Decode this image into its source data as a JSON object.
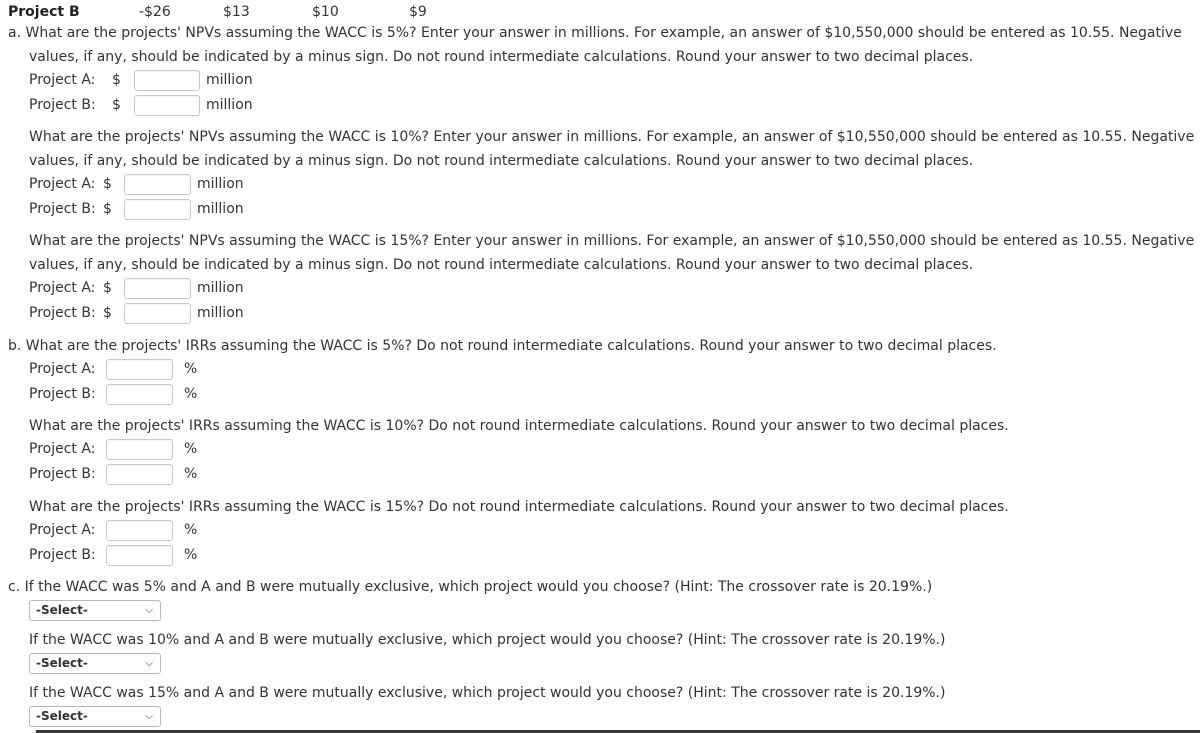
{
  "cash_flow_row": {
    "label": "Project B",
    "values": [
      "-$26",
      "$13",
      "$10",
      "$9"
    ]
  },
  "part_a": {
    "questions": [
      {
        "prefix": "a.",
        "line1": "What are the projects' NPVs assuming the WACC is 5%? Enter your answer in millions. For example, an answer of $10,550,000 should be entered as 10.55. Negative",
        "line2": "values, if any, should be indicated by a minus sign. Do not round intermediate calculations. Round your answer to two decimal places.",
        "rows": [
          {
            "label": "Project A:",
            "currency": "$",
            "value": "",
            "unit": "million"
          },
          {
            "label": "Project B:",
            "currency": "$",
            "value": "",
            "unit": "million"
          }
        ]
      },
      {
        "prefix": "",
        "line1": "What are the projects' NPVs assuming the WACC is 10%? Enter your answer in millions. For example, an answer of $10,550,000 should be entered as 10.55. Negative",
        "line2": "values, if any, should be indicated by a minus sign. Do not round intermediate calculations. Round your answer to two decimal places.",
        "rows": [
          {
            "label": "Project A:",
            "currency": "$",
            "value": "",
            "unit": "million"
          },
          {
            "label": "Project B:",
            "currency": "$",
            "value": "",
            "unit": "million"
          }
        ]
      },
      {
        "prefix": "",
        "line1": "What are the projects' NPVs assuming the WACC is 15%? Enter your answer in millions. For example, an answer of $10,550,000 should be entered as 10.55. Negative",
        "line2": "values, if any, should be indicated by a minus sign. Do not round intermediate calculations. Round your answer to two decimal places.",
        "rows": [
          {
            "label": "Project A:",
            "currency": "$",
            "value": "",
            "unit": "million"
          },
          {
            "label": "Project B:",
            "currency": "$",
            "value": "",
            "unit": "million"
          }
        ]
      }
    ]
  },
  "part_b": {
    "questions": [
      {
        "text": "b. What are the projects' IRRs assuming the WACC is 5%? Do not round intermediate calculations. Round your answer to two decimal places.",
        "rows": [
          {
            "label": "Project A:",
            "value": "",
            "unit": "%"
          },
          {
            "label": "Project B:",
            "value": "",
            "unit": "%"
          }
        ]
      },
      {
        "text": "What are the projects' IRRs assuming the WACC is 10%? Do not round intermediate calculations. Round your answer to two decimal places.",
        "rows": [
          {
            "label": "Project A:",
            "value": "",
            "unit": "%"
          },
          {
            "label": "Project B:",
            "value": "",
            "unit": "%"
          }
        ]
      },
      {
        "text": "What are the projects' IRRs assuming the WACC is 15%? Do not round intermediate calculations. Round your answer to two decimal places.",
        "rows": [
          {
            "label": "Project A:",
            "value": "",
            "unit": "%"
          },
          {
            "label": "Project B:",
            "value": "",
            "unit": "%"
          }
        ]
      }
    ]
  },
  "part_c": {
    "questions": [
      {
        "text": "c. If the WACC was 5% and A and B were mutually exclusive, which project would you choose? (Hint: The crossover rate is 20.19%.)",
        "select": "-Select-"
      },
      {
        "text": "If the WACC was 10% and A and B were mutually exclusive, which project would you choose? (Hint: The crossover rate is 20.19%.)",
        "select": "-Select-"
      },
      {
        "text": "If the WACC was 15% and A and B were mutually exclusive, which project would you choose? (Hint: The crossover rate is 20.19%.)",
        "select": "-Select-"
      }
    ]
  }
}
